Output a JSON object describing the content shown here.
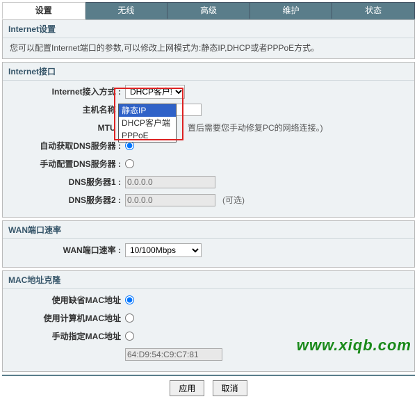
{
  "tabs": {
    "items": [
      "设置",
      "无线",
      "高级",
      "维护",
      "状态"
    ],
    "activeIndex": 0
  },
  "section_internet": {
    "title": "Internet设置",
    "desc": "您可以配置Internet端口的参数,可以修改上网模式为:静态IP,DHCP或者PPPoE方式。"
  },
  "section_iface": {
    "title": "Internet接口"
  },
  "form": {
    "access_mode": {
      "label": "Internet接入方式 :",
      "value": "DHCP客户端",
      "options": [
        "静态IP",
        "DHCP客户端",
        "PPPoE"
      ]
    },
    "hostname": {
      "label": "主机名称 :",
      "value": ""
    },
    "mtu": {
      "label": "MTU :",
      "note": "置后需要您手动修复PC的网络连接。)"
    },
    "auto_dns": {
      "label": "自动获取DNS服务器 :"
    },
    "manual_dns": {
      "label": "手动配置DNS服务器 :"
    },
    "dns1": {
      "label": "DNS服务器1 :",
      "value": "0.0.0.0"
    },
    "dns2": {
      "label": "DNS服务器2 :",
      "value": "0.0.0.0",
      "optional": "(可选)"
    }
  },
  "section_wan": {
    "title": "WAN端口速率",
    "label": "WAN端口速率 :",
    "value": "10/100Mbps"
  },
  "section_mac": {
    "title": "MAC地址克隆",
    "opt_default": "使用缺省MAC地址",
    "opt_pc": "使用计算机MAC地址",
    "opt_manual": "手动指定MAC地址",
    "mac_value": "64:D9:54:C9:C7:81"
  },
  "buttons": {
    "apply": "应用",
    "cancel": "取消"
  },
  "watermark": "www.xiqb.com"
}
